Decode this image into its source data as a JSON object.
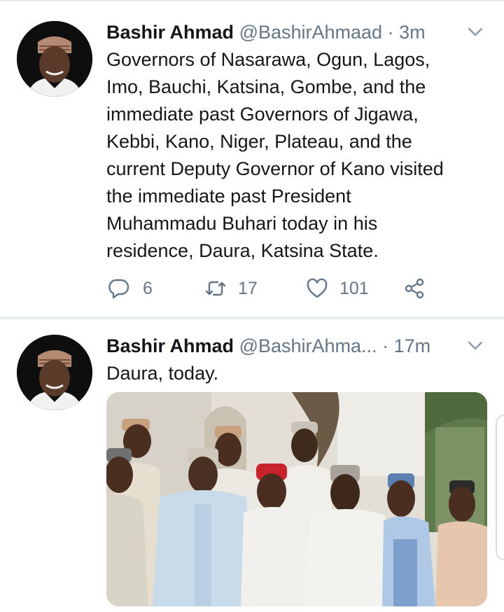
{
  "tweets": [
    {
      "name": "Bashir Ahmad",
      "handle": "@BashirAhmaad",
      "dot": "·",
      "time": "3m",
      "text_lines": [
        "Governors of Nasarawa, Ogun, Lagos,",
        "Imo, Bauchi, Katsina, Gombe, and the",
        "immediate past Governors of Jigawa,",
        "Kebbi, Kano, Niger, Plateau, and the",
        "current Deputy Governor of Kano visited",
        "the immediate past President",
        "Muhammadu Buhari today in his",
        "residence, Daura, Katsina State."
      ],
      "actions": {
        "replies": "6",
        "retweets": "17",
        "likes": "101"
      },
      "icons": {
        "reply": "reply-icon",
        "retweet": "retweet-icon",
        "like": "heart-icon",
        "share": "share-icon",
        "caret": "chevron-down-icon"
      }
    },
    {
      "name": "Bashir Ahmad",
      "handle": "@BashirAhma...",
      "dot": "·",
      "time": "17m",
      "text_lines": [
        "Daura, today."
      ]
    }
  ],
  "colors": {
    "name": "#14171a",
    "secondary": "#657786",
    "divider": "#e6ecf0"
  }
}
